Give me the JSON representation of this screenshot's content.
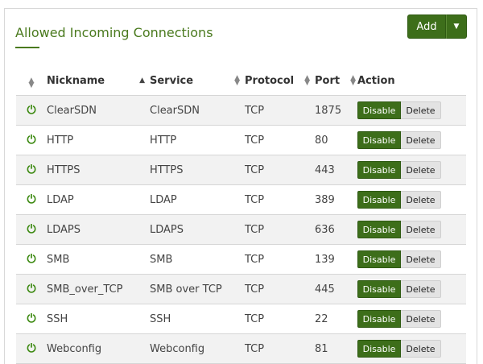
{
  "panel": {
    "title": "Allowed Incoming Connections",
    "add_label": "Add"
  },
  "columns": {
    "nickname": "Nickname",
    "service": "Service",
    "protocol": "Protocol",
    "port": "Port",
    "action": "Action"
  },
  "icons": {
    "power": "power-icon",
    "sort": "sort-icon",
    "caret": "caret-down-icon"
  },
  "colors": {
    "accent": "#3d6e1a",
    "title": "#4a7a1e",
    "power": "#3d8a12"
  },
  "rows": [
    {
      "nickname": "ClearSDN",
      "service": "ClearSDN",
      "protocol": "TCP",
      "port": "1875",
      "disable": "Disable",
      "delete": "Delete"
    },
    {
      "nickname": "HTTP",
      "service": "HTTP",
      "protocol": "TCP",
      "port": "80",
      "disable": "Disable",
      "delete": "Delete"
    },
    {
      "nickname": "HTTPS",
      "service": "HTTPS",
      "protocol": "TCP",
      "port": "443",
      "disable": "Disable",
      "delete": "Delete"
    },
    {
      "nickname": "LDAP",
      "service": "LDAP",
      "protocol": "TCP",
      "port": "389",
      "disable": "Disable",
      "delete": "Delete"
    },
    {
      "nickname": "LDAPS",
      "service": "LDAPS",
      "protocol": "TCP",
      "port": "636",
      "disable": "Disable",
      "delete": "Delete"
    },
    {
      "nickname": "SMB",
      "service": "SMB",
      "protocol": "TCP",
      "port": "139",
      "disable": "Disable",
      "delete": "Delete"
    },
    {
      "nickname": "SMB_over_TCP",
      "service": "SMB over TCP",
      "protocol": "TCP",
      "port": "445",
      "disable": "Disable",
      "delete": "Delete"
    },
    {
      "nickname": "SSH",
      "service": "SSH",
      "protocol": "TCP",
      "port": "22",
      "disable": "Disable",
      "delete": "Delete"
    },
    {
      "nickname": "Webconfig",
      "service": "Webconfig",
      "protocol": "TCP",
      "port": "81",
      "disable": "Disable",
      "delete": "Delete"
    }
  ]
}
